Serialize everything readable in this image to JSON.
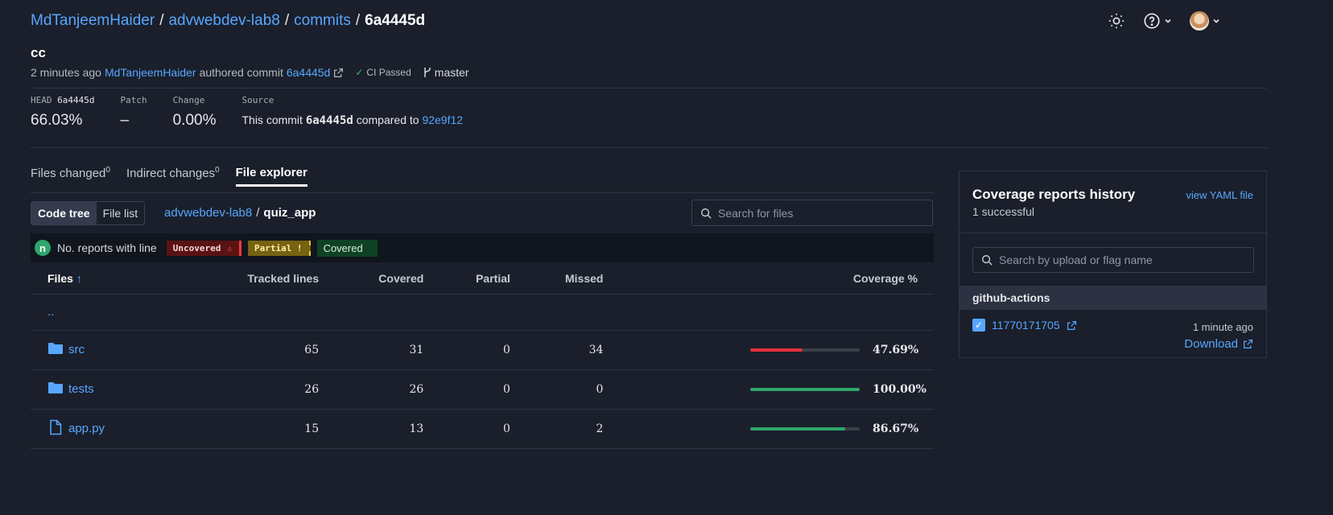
{
  "breadcrumb": {
    "owner": "MdTanjeemHaider",
    "repo": "advwebdev-lab8",
    "section": "commits",
    "commit": "6a4445d"
  },
  "commit": {
    "message": "cc",
    "time_ago": "2 minutes ago",
    "author": "MdTanjeemHaider",
    "authored_text": "authored commit",
    "sha": "6a4445d",
    "ci_status": "CI Passed",
    "branch": "master"
  },
  "stats": {
    "head_label": "HEAD",
    "head_sha": "6a4445d",
    "head_value": "66.03%",
    "patch_label": "Patch",
    "patch_value": "–",
    "change_label": "Change",
    "change_value": "0.00%",
    "source_label": "Source",
    "source_prefix": "This commit",
    "source_sha": "6a4445d",
    "source_mid": "compared to",
    "source_base": "92e9f12"
  },
  "tabs": [
    {
      "label": "Files changed",
      "count": "0"
    },
    {
      "label": "Indirect changes",
      "count": "0"
    },
    {
      "label": "File explorer"
    }
  ],
  "view_toggle": {
    "tree": "Code tree",
    "list": "File list"
  },
  "path": {
    "repo": "advwebdev-lab8",
    "dir": "quiz_app"
  },
  "search_files": {
    "placeholder": "Search for files"
  },
  "legend": {
    "n": "n",
    "no_reports": "No. reports with line",
    "uncovered": "Uncovered",
    "partial": "Partial !",
    "covered": "Covered"
  },
  "table": {
    "headers": {
      "files": "Files",
      "tracked": "Tracked lines",
      "covered": "Covered",
      "partial": "Partial",
      "missed": "Missed",
      "coverage": "Coverage %"
    },
    "up": "..",
    "rows": [
      {
        "name": "src",
        "type": "folder",
        "tracked": "65",
        "covered": "31",
        "partial": "0",
        "missed": "34",
        "coverage": "47.69%",
        "fraction": 0.4769,
        "color": "#e5303b"
      },
      {
        "name": "tests",
        "type": "folder",
        "tracked": "26",
        "covered": "26",
        "partial": "0",
        "missed": "0",
        "coverage": "100.00%",
        "fraction": 1.0,
        "color": "#2ea66d"
      },
      {
        "name": "app.py",
        "type": "file",
        "tracked": "15",
        "covered": "13",
        "partial": "0",
        "missed": "2",
        "coverage": "86.67%",
        "fraction": 0.8667,
        "color": "#2ea66d"
      }
    ]
  },
  "reports": {
    "title": "Coverage reports history",
    "subtitle": "1 successful",
    "yaml_link": "view YAML file",
    "search_placeholder": "Search by upload or flag name",
    "flag": "github-actions",
    "upload_id": "11770171705",
    "upload_time": "1 minute ago",
    "download": "Download"
  }
}
